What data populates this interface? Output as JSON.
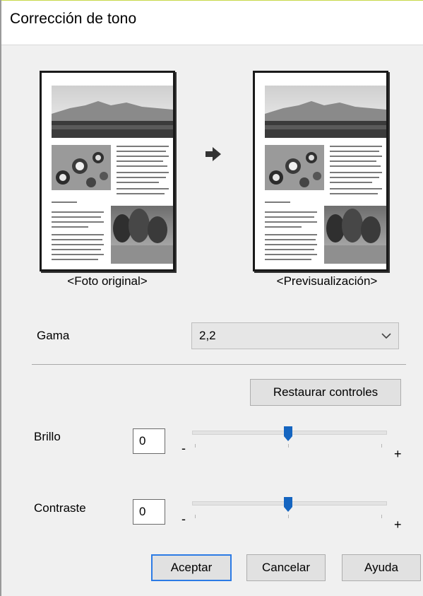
{
  "dialog": {
    "title": "Corrección de tono"
  },
  "preview": {
    "original_caption": "<Foto original>",
    "preview_caption": "<Previsualización>",
    "arrow_icon": "arrow-right-icon"
  },
  "gamma": {
    "label": "Gama",
    "value": "2,2",
    "icon": "chevron-down-icon"
  },
  "reset_button": "Restaurar controles",
  "brightness": {
    "label": "Brillo",
    "value": "0",
    "level": 0.5,
    "min_label": "-",
    "max_label": "+"
  },
  "contrast": {
    "label": "Contraste",
    "value": "0",
    "level": 0.5,
    "min_label": "-",
    "max_label": "+"
  },
  "buttons": {
    "ok": "Aceptar",
    "cancel": "Cancelar",
    "help": "Ayuda"
  },
  "colors": {
    "accent": "#2c7be5",
    "slider_thumb": "#1565c0"
  }
}
